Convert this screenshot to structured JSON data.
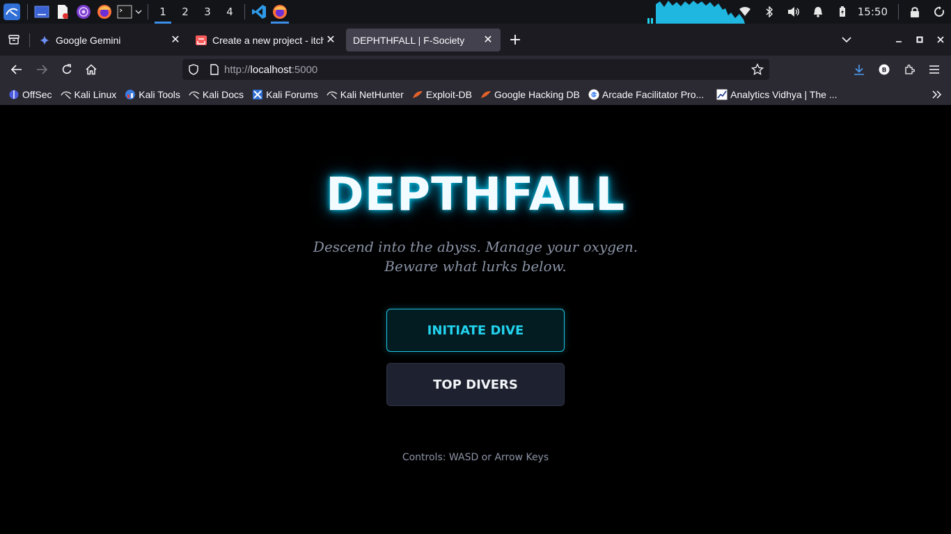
{
  "taskbar": {
    "workspaces": [
      "1",
      "2",
      "3",
      "4"
    ],
    "clock": "15:50"
  },
  "tabs": [
    {
      "title": "Google Gemini",
      "favicon": "gemini-icon"
    },
    {
      "title": "Create a new project - itch",
      "favicon": "itch-icon"
    },
    {
      "title": "DEPHTHFALL | F-Society",
      "favicon": "none"
    }
  ],
  "url": {
    "protocol": "http://",
    "host": "localhost",
    "port": ":5000"
  },
  "bookmarks": [
    {
      "label": "OffSec",
      "icon": "offsec-icon"
    },
    {
      "label": "Kali Linux",
      "icon": "kali-icon"
    },
    {
      "label": "Kali Tools",
      "icon": "kali-tools-icon"
    },
    {
      "label": "Kali Docs",
      "icon": "kali-icon"
    },
    {
      "label": "Kali Forums",
      "icon": "kali-forums-icon"
    },
    {
      "label": "Kali NetHunter",
      "icon": "kali-icon"
    },
    {
      "label": "Exploit-DB",
      "icon": "exploitdb-icon"
    },
    {
      "label": "Google Hacking DB",
      "icon": "exploitdb-icon"
    },
    {
      "label": "Arcade Facilitator Pro...",
      "icon": "google-icon"
    },
    {
      "label": "Analytics Vidhya | The ...",
      "icon": "analytics-icon"
    }
  ],
  "page": {
    "title": "DEPTHFALL",
    "tagline": "Descend into the abyss. Manage your oxygen. Beware what lurks below.",
    "primary_button": "INITIATE DIVE",
    "secondary_button": "TOP DIVERS",
    "controls_hint": "Controls: WASD or Arrow Keys"
  },
  "colors": {
    "accent": "#22d3ee",
    "background": "#000000",
    "browser_chrome": "#2b2a33"
  }
}
